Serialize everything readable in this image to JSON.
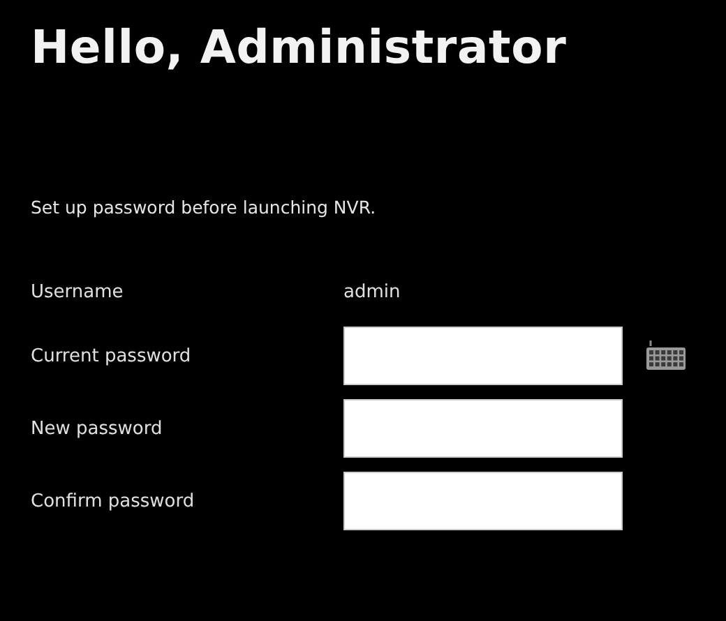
{
  "title": "Hello, Administrator",
  "message": "Set up password before launching NVR.",
  "fields": [
    {
      "kind": "text",
      "label": "Username",
      "value": "admin"
    },
    {
      "kind": "password",
      "label": "Current password",
      "keyboard": true
    },
    {
      "kind": "password",
      "label": "New password",
      "keyboard": false
    },
    {
      "kind": "password",
      "label": "Confirm password",
      "keyboard": false
    }
  ]
}
